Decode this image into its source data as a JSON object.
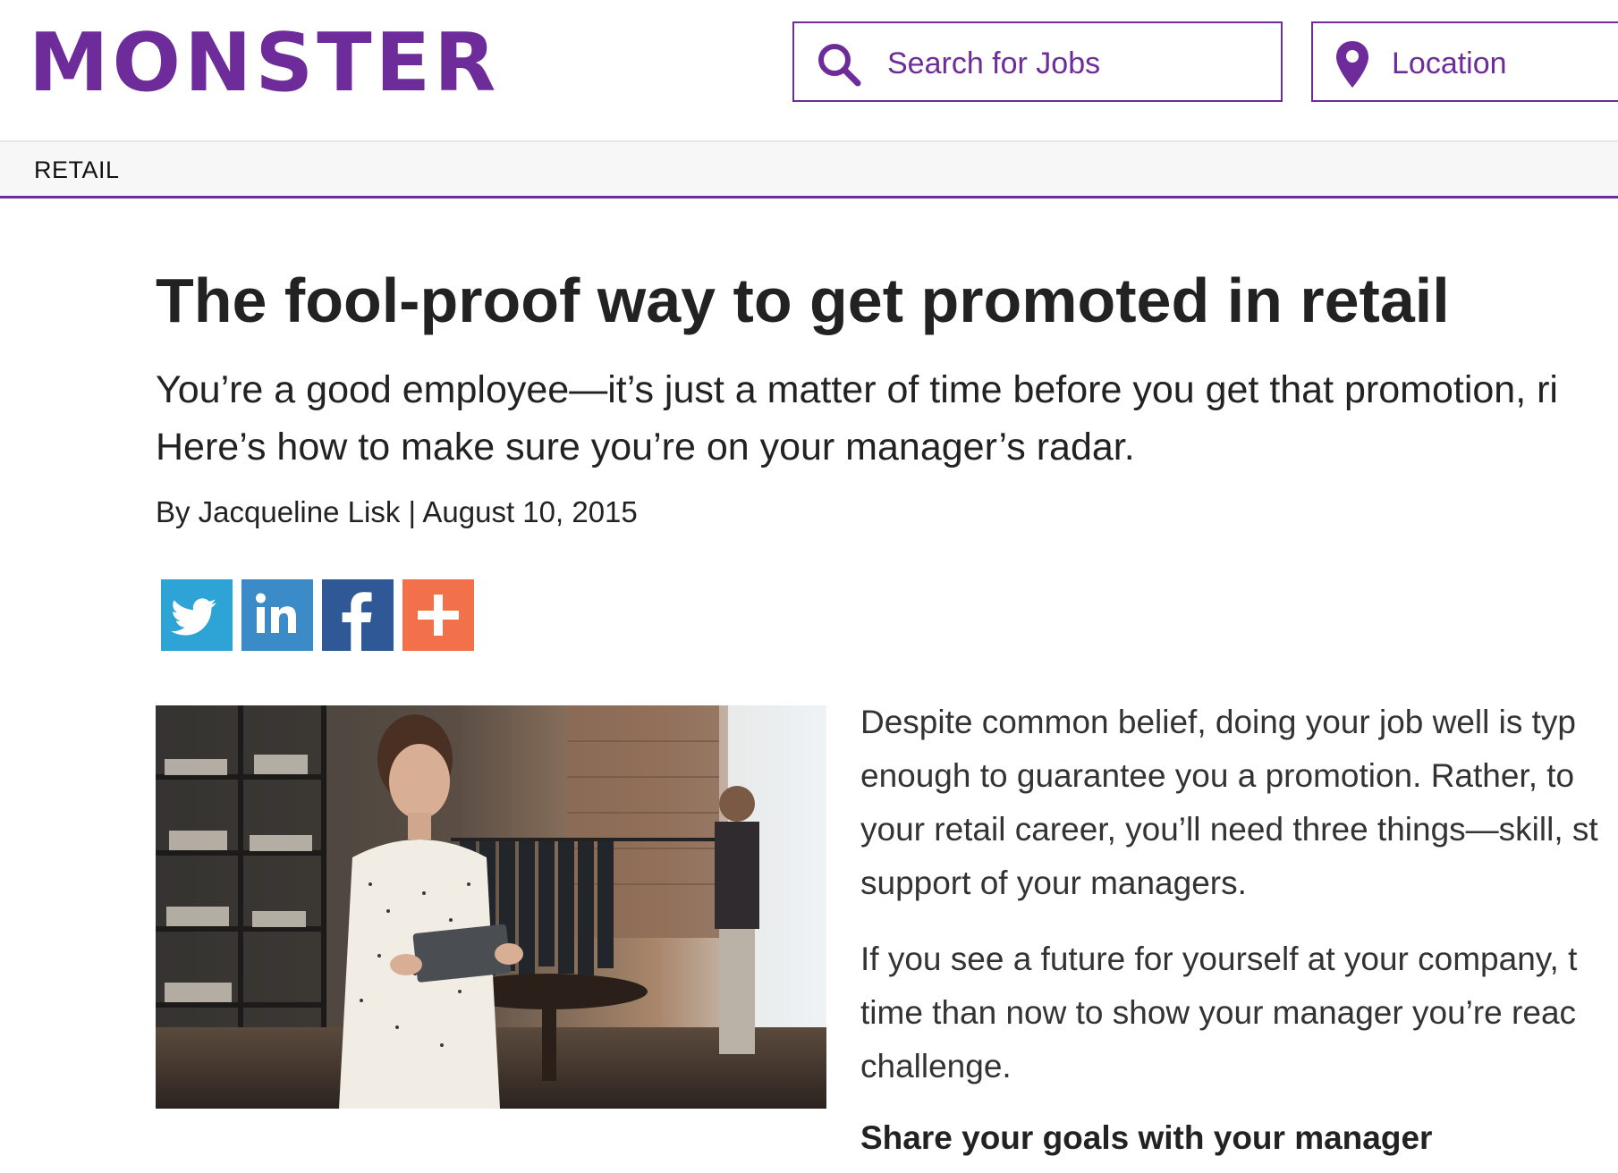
{
  "header": {
    "logo": "MONSTER",
    "search": {
      "placeholder": "Search for Jobs",
      "icon": "search-icon"
    },
    "location": {
      "placeholder": "Location",
      "icon": "map-pin-icon"
    },
    "brand_color": "#6e2c9a"
  },
  "category": {
    "label": "RETAIL"
  },
  "article": {
    "title": "The fool-proof way to get promoted in retail",
    "subtitle_lines": [
      "You’re a good employee—it’s just a matter of time before you get that promotion, ri",
      "Here’s how to make sure you’re on your manager’s radar."
    ],
    "byline": "By Jacqueline Lisk | August 10, 2015",
    "share": [
      {
        "name": "twitter",
        "icon": "twitter-icon",
        "color": "#2ea4d6"
      },
      {
        "name": "linkedin",
        "icon": "linkedin-icon",
        "color": "#3a8bc7"
      },
      {
        "name": "facebook",
        "icon": "facebook-icon",
        "color": "#2e5896"
      },
      {
        "name": "more",
        "icon": "plus-icon",
        "color": "#f2704a"
      }
    ],
    "paragraph1_lines": [
      "Despite common belief, doing your job well is typ",
      "enough to guarantee you a promotion. Rather, to",
      "your retail career, you’ll need three things—skill, st",
      "support of your managers."
    ],
    "paragraph2_lines": [
      "If you see a future for yourself at your company, t",
      "time than now to show your manager you’re reac",
      "challenge."
    ],
    "subhead": "Share your goals with your manager"
  }
}
